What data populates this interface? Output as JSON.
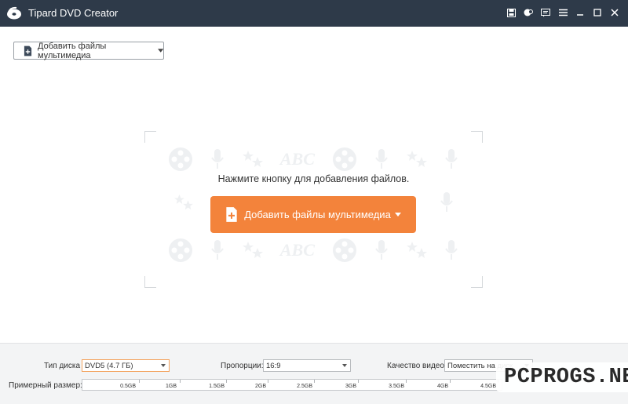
{
  "app": {
    "title": "Tipard DVD Creator"
  },
  "titlebar": {
    "icons": [
      "save-icon",
      "feedback-icon",
      "chat-icon",
      "menu-icon",
      "minimize-icon",
      "maximize-icon",
      "close-icon"
    ]
  },
  "toolbar": {
    "add_files_label": "Добавить файлы мультимедиа"
  },
  "drop_area": {
    "hint": "Нажмите кнопку для добавления файлов.",
    "button_label": "Добавить файлы мультимедиа",
    "background_text": "ABC"
  },
  "settings": {
    "disc_type": {
      "label": "Тип диска",
      "value": "DVD5 (4.7 ГБ)"
    },
    "aspect": {
      "label": "Пропорции:",
      "value": "16:9"
    },
    "quality": {
      "label": "Качество видео:",
      "value": "Поместить на диск"
    },
    "size": {
      "label": "Примерный размер:",
      "ticks": [
        "0.5GB",
        "1GB",
        "1.5GB",
        "2GB",
        "2.5GB",
        "3GB",
        "3.5GB",
        "4GB",
        "4.5GB"
      ]
    }
  },
  "colors": {
    "titlebar": "#2e3a49",
    "accent": "#f3833b"
  },
  "watermark": "PCPROGS.NET"
}
